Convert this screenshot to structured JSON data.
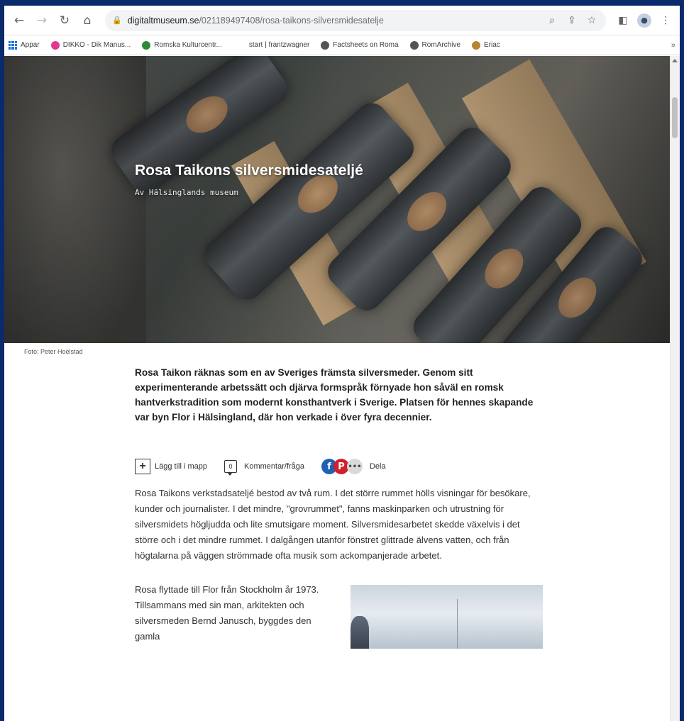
{
  "browser": {
    "url_host": "digitaltmuseum.se",
    "url_path": "/021189497408/rosa-taikons-silversmidesatelje",
    "bookmarks": [
      {
        "label": "Appar",
        "color": "#1a73e8"
      },
      {
        "label": "DIKKO - Dik Manus...",
        "color": "#e3368f"
      },
      {
        "label": "Romska Kulturcentr...",
        "color": "#2e8b3a"
      },
      {
        "label": "start | frantzwagner",
        "color": "#ffffff"
      },
      {
        "label": "Factsheets on Roma",
        "color": "#555555"
      },
      {
        "label": "RomArchive",
        "color": "#555555"
      },
      {
        "label": "Eriac",
        "color": "#b8862e"
      }
    ],
    "bookmarks_more": "»"
  },
  "hero": {
    "title": "Rosa Taikons silversmidesateljé",
    "subtitle": "Av Hälsinglands museum",
    "photo_credit": "Foto: Peter Hoelstad"
  },
  "article": {
    "lead": "Rosa Taikon räknas som en av Sveriges främsta silversmeder. Genom sitt experimenterande arbetssätt och djärva formspråk förnyade hon såväl en romsk hantverkstradition som modernt konsthantverk i Sverige. Platsen för hennes skapande var byn Flor i Hälsingland, där hon verkade i över fyra decennier.",
    "actions": {
      "add_to_folder": "Lägg till i mapp",
      "comment_count": "0",
      "comment": "Kommentar/fråga",
      "share": "Dela"
    },
    "paragraph1": "Rosa Taikons verkstadsateljé bestod av två rum. I det större rummet hölls visningar för besökare, kunder och journalister. I det mindre, \"grovrummet\", fanns maskinparken och utrustning för silversmidets högljudda och lite smutsigare moment. Silversmidesarbetet skedde växelvis i det större och i det mindre rummet. I dalgången utanför fönstret glittrade älvens vatten, och från högtalarna på väggen strömmade ofta musik som ackompanjerade arbetet.",
    "paragraph2": "Rosa flyttade till Flor från Stockholm år 1973. Tillsammans med sin man, arkitekten och silversmeden Bernd Janusch, byggdes den gamla"
  },
  "colors": {
    "accent_frame": "#0b2a6b",
    "facebook": "#1f5fb5",
    "pinterest": "#d0212a"
  }
}
